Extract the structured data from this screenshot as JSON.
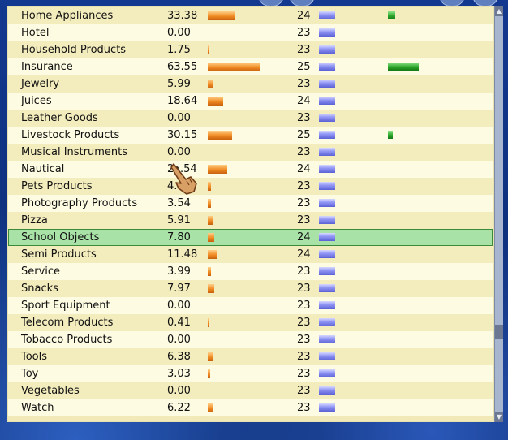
{
  "rows": [
    {
      "name": "Home Appliances",
      "value": "33.38",
      "orange": 0.53,
      "count": "24",
      "green": 0.14
    },
    {
      "name": "Hotel",
      "value": "0.00",
      "orange": 0,
      "count": "23",
      "green": 0
    },
    {
      "name": "Household Products",
      "value": "1.75",
      "orange": 0.03,
      "count": "23",
      "green": 0
    },
    {
      "name": "Insurance",
      "value": "63.55",
      "orange": 1.0,
      "count": "25",
      "green": 0.6
    },
    {
      "name": "Jewelry",
      "value": "5.99",
      "orange": 0.09,
      "count": "23",
      "green": 0
    },
    {
      "name": "Juices",
      "value": "18.64",
      "orange": 0.29,
      "count": "24",
      "green": 0
    },
    {
      "name": "Leather Goods",
      "value": "0.00",
      "orange": 0,
      "count": "23",
      "green": 0
    },
    {
      "name": "Livestock Products",
      "value": "30.15",
      "orange": 0.47,
      "count": "25",
      "green": 0.09
    },
    {
      "name": "Musical Instruments",
      "value": "0.00",
      "orange": 0,
      "count": "23",
      "green": 0
    },
    {
      "name": "Nautical",
      "value": "2•.54",
      "orange": 0.37,
      "count": "24",
      "green": 0
    },
    {
      "name": "Pets Products",
      "value": "4.41",
      "orange": 0.07,
      "count": "23",
      "green": 0
    },
    {
      "name": "Photography Products",
      "value": "3.54",
      "orange": 0.06,
      "count": "23",
      "green": 0
    },
    {
      "name": "Pizza",
      "value": "5.91",
      "orange": 0.09,
      "count": "23",
      "green": 0
    },
    {
      "name": "School Objects",
      "value": "7.80",
      "orange": 0.12,
      "count": "24",
      "green": 0,
      "selected": true
    },
    {
      "name": "Semi Products",
      "value": "11.48",
      "orange": 0.18,
      "count": "24",
      "green": 0
    },
    {
      "name": "Service",
      "value": "3.99",
      "orange": 0.06,
      "count": "23",
      "green": 0
    },
    {
      "name": "Snacks",
      "value": "7.97",
      "orange": 0.12,
      "count": "23",
      "green": 0
    },
    {
      "name": "Sport Equipment",
      "value": "0.00",
      "orange": 0,
      "count": "23",
      "green": 0
    },
    {
      "name": "Telecom Products",
      "value": "0.41",
      "orange": 0.01,
      "count": "23",
      "green": 0
    },
    {
      "name": "Tobacco Products",
      "value": "0.00",
      "orange": 0,
      "count": "23",
      "green": 0
    },
    {
      "name": "Tools",
      "value": "6.38",
      "orange": 0.1,
      "count": "23",
      "green": 0
    },
    {
      "name": "Toy",
      "value": "3.03",
      "orange": 0.05,
      "count": "23",
      "green": 0
    },
    {
      "name": "Vegetables",
      "value": "0.00",
      "orange": 0,
      "count": "23",
      "green": 0
    },
    {
      "name": "Watch",
      "value": "6.22",
      "orange": 0.1,
      "count": "23",
      "green": 0
    }
  ],
  "colors": {
    "orange_bar": "#f08a22",
    "blue_bar": "#8e93f3",
    "green_bar": "#2aa52a",
    "selection": "#a9e2a6"
  },
  "icons": {
    "scroll_up": "▲",
    "scroll_down": "▼",
    "cursor": "hand-pointer-icon"
  }
}
